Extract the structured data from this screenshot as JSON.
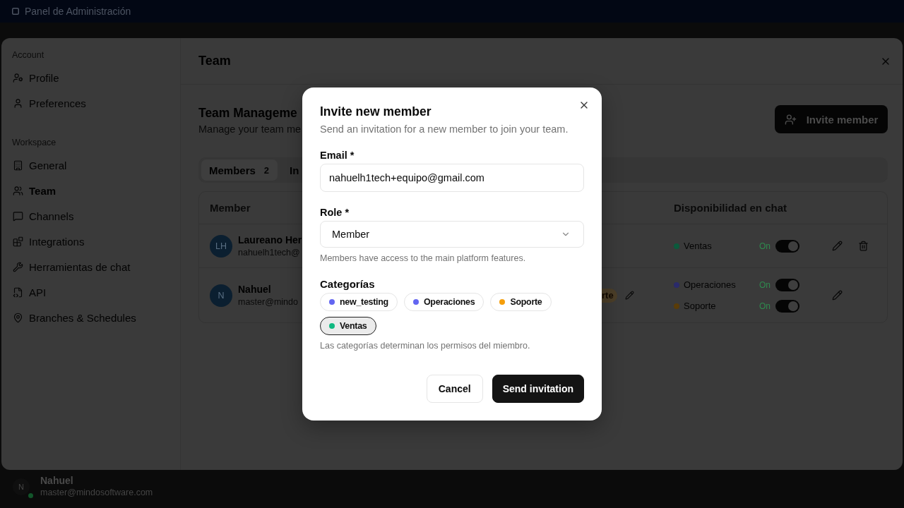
{
  "top_bar": {
    "title": "Panel de Administración"
  },
  "settings": {
    "sidebar": {
      "sections": [
        {
          "label": "Account",
          "items": [
            {
              "label": "Profile",
              "selected": false
            },
            {
              "label": "Preferences",
              "selected": false
            }
          ]
        },
        {
          "label": "Workspace",
          "items": [
            {
              "label": "General",
              "selected": false
            },
            {
              "label": "Team",
              "selected": true
            },
            {
              "label": "Channels",
              "selected": false
            },
            {
              "label": "Integrations",
              "selected": false
            },
            {
              "label": "Herramientas de chat",
              "selected": false
            },
            {
              "label": "API",
              "selected": false
            },
            {
              "label": "Branches & Schedules",
              "selected": false
            }
          ]
        }
      ]
    },
    "header": {
      "title": "Team"
    },
    "section": {
      "title": "Team Manageme",
      "description": "Manage your team me",
      "invite_button": "Invite member"
    },
    "tabs": [
      {
        "label": "Members",
        "count": "2",
        "selected": true
      },
      {
        "label": "In",
        "selected": false
      }
    ],
    "table": {
      "columns": [
        "Member",
        "Disponibilidad en chat"
      ],
      "rows": [
        {
          "avatar": "LH",
          "name": "Laureano Her",
          "email": "nahuelh1tech@",
          "can_delete": true,
          "availability": [
            {
              "category": "Ventas",
              "color": "#0b5a3c",
              "status": "On",
              "on": true
            }
          ]
        },
        {
          "avatar": "N",
          "name": "Nahuel",
          "email": "master@mindo",
          "badge": "rte",
          "can_delete": false,
          "availability": [
            {
              "category": "Operaciones",
              "color": "#2a2a6a",
              "status": "On",
              "on": true
            },
            {
              "category": "Soporte",
              "color": "#5a3c08",
              "status": "On",
              "on": true
            }
          ]
        }
      ]
    }
  },
  "dialog": {
    "title": "Invite new member",
    "description": "Send an invitation for a new member to join your team.",
    "fields": [
      {
        "kind": "text",
        "label": "Email *",
        "value": "nahuelh1tech+equipo@gmail.com"
      },
      {
        "kind": "select",
        "label": "Role *",
        "value": "Member",
        "hint": "Members have access to the main platform features."
      }
    ],
    "categories": {
      "label": "Categorías",
      "options": [
        {
          "label": "new_testing",
          "color": "#6366f1",
          "selected": false
        },
        {
          "label": "Operaciones",
          "color": "#6366f1",
          "selected": false
        },
        {
          "label": "Soporte",
          "color": "#f59e0b",
          "selected": false
        },
        {
          "label": "Ventas",
          "color": "#10b981",
          "selected": true
        }
      ],
      "hint": "Las categorías determinan los permisos del miembro."
    },
    "buttons": [
      {
        "label": "Cancel",
        "kind": "secondary"
      },
      {
        "label": "Send invitation",
        "kind": "primary"
      }
    ]
  },
  "user": {
    "avatar": "N",
    "name": "Nahuel",
    "email": "master@mindosoftware.com",
    "online": true
  }
}
